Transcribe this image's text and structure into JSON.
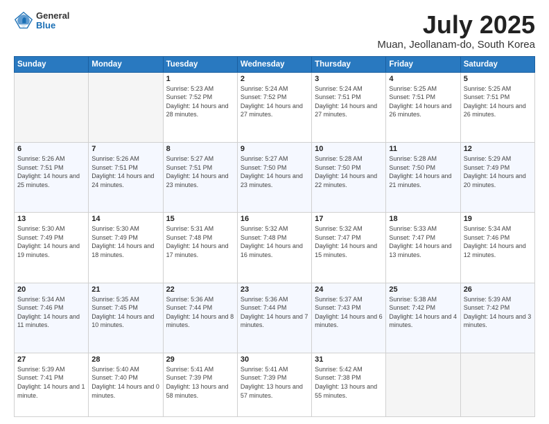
{
  "logo": {
    "general": "General",
    "blue": "Blue"
  },
  "title": {
    "month_year": "July 2025",
    "location": "Muan, Jeollanam-do, South Korea"
  },
  "weekdays": [
    "Sunday",
    "Monday",
    "Tuesday",
    "Wednesday",
    "Thursday",
    "Friday",
    "Saturday"
  ],
  "weeks": [
    [
      {
        "day": "",
        "sunrise": "",
        "sunset": "",
        "daylight": ""
      },
      {
        "day": "",
        "sunrise": "",
        "sunset": "",
        "daylight": ""
      },
      {
        "day": "1",
        "sunrise": "Sunrise: 5:23 AM",
        "sunset": "Sunset: 7:52 PM",
        "daylight": "Daylight: 14 hours and 28 minutes."
      },
      {
        "day": "2",
        "sunrise": "Sunrise: 5:24 AM",
        "sunset": "Sunset: 7:52 PM",
        "daylight": "Daylight: 14 hours and 27 minutes."
      },
      {
        "day": "3",
        "sunrise": "Sunrise: 5:24 AM",
        "sunset": "Sunset: 7:51 PM",
        "daylight": "Daylight: 14 hours and 27 minutes."
      },
      {
        "day": "4",
        "sunrise": "Sunrise: 5:25 AM",
        "sunset": "Sunset: 7:51 PM",
        "daylight": "Daylight: 14 hours and 26 minutes."
      },
      {
        "day": "5",
        "sunrise": "Sunrise: 5:25 AM",
        "sunset": "Sunset: 7:51 PM",
        "daylight": "Daylight: 14 hours and 26 minutes."
      }
    ],
    [
      {
        "day": "6",
        "sunrise": "Sunrise: 5:26 AM",
        "sunset": "Sunset: 7:51 PM",
        "daylight": "Daylight: 14 hours and 25 minutes."
      },
      {
        "day": "7",
        "sunrise": "Sunrise: 5:26 AM",
        "sunset": "Sunset: 7:51 PM",
        "daylight": "Daylight: 14 hours and 24 minutes."
      },
      {
        "day": "8",
        "sunrise": "Sunrise: 5:27 AM",
        "sunset": "Sunset: 7:51 PM",
        "daylight": "Daylight: 14 hours and 23 minutes."
      },
      {
        "day": "9",
        "sunrise": "Sunrise: 5:27 AM",
        "sunset": "Sunset: 7:50 PM",
        "daylight": "Daylight: 14 hours and 23 minutes."
      },
      {
        "day": "10",
        "sunrise": "Sunrise: 5:28 AM",
        "sunset": "Sunset: 7:50 PM",
        "daylight": "Daylight: 14 hours and 22 minutes."
      },
      {
        "day": "11",
        "sunrise": "Sunrise: 5:28 AM",
        "sunset": "Sunset: 7:50 PM",
        "daylight": "Daylight: 14 hours and 21 minutes."
      },
      {
        "day": "12",
        "sunrise": "Sunrise: 5:29 AM",
        "sunset": "Sunset: 7:49 PM",
        "daylight": "Daylight: 14 hours and 20 minutes."
      }
    ],
    [
      {
        "day": "13",
        "sunrise": "Sunrise: 5:30 AM",
        "sunset": "Sunset: 7:49 PM",
        "daylight": "Daylight: 14 hours and 19 minutes."
      },
      {
        "day": "14",
        "sunrise": "Sunrise: 5:30 AM",
        "sunset": "Sunset: 7:49 PM",
        "daylight": "Daylight: 14 hours and 18 minutes."
      },
      {
        "day": "15",
        "sunrise": "Sunrise: 5:31 AM",
        "sunset": "Sunset: 7:48 PM",
        "daylight": "Daylight: 14 hours and 17 minutes."
      },
      {
        "day": "16",
        "sunrise": "Sunrise: 5:32 AM",
        "sunset": "Sunset: 7:48 PM",
        "daylight": "Daylight: 14 hours and 16 minutes."
      },
      {
        "day": "17",
        "sunrise": "Sunrise: 5:32 AM",
        "sunset": "Sunset: 7:47 PM",
        "daylight": "Daylight: 14 hours and 15 minutes."
      },
      {
        "day": "18",
        "sunrise": "Sunrise: 5:33 AM",
        "sunset": "Sunset: 7:47 PM",
        "daylight": "Daylight: 14 hours and 13 minutes."
      },
      {
        "day": "19",
        "sunrise": "Sunrise: 5:34 AM",
        "sunset": "Sunset: 7:46 PM",
        "daylight": "Daylight: 14 hours and 12 minutes."
      }
    ],
    [
      {
        "day": "20",
        "sunrise": "Sunrise: 5:34 AM",
        "sunset": "Sunset: 7:46 PM",
        "daylight": "Daylight: 14 hours and 11 minutes."
      },
      {
        "day": "21",
        "sunrise": "Sunrise: 5:35 AM",
        "sunset": "Sunset: 7:45 PM",
        "daylight": "Daylight: 14 hours and 10 minutes."
      },
      {
        "day": "22",
        "sunrise": "Sunrise: 5:36 AM",
        "sunset": "Sunset: 7:44 PM",
        "daylight": "Daylight: 14 hours and 8 minutes."
      },
      {
        "day": "23",
        "sunrise": "Sunrise: 5:36 AM",
        "sunset": "Sunset: 7:44 PM",
        "daylight": "Daylight: 14 hours and 7 minutes."
      },
      {
        "day": "24",
        "sunrise": "Sunrise: 5:37 AM",
        "sunset": "Sunset: 7:43 PM",
        "daylight": "Daylight: 14 hours and 6 minutes."
      },
      {
        "day": "25",
        "sunrise": "Sunrise: 5:38 AM",
        "sunset": "Sunset: 7:42 PM",
        "daylight": "Daylight: 14 hours and 4 minutes."
      },
      {
        "day": "26",
        "sunrise": "Sunrise: 5:39 AM",
        "sunset": "Sunset: 7:42 PM",
        "daylight": "Daylight: 14 hours and 3 minutes."
      }
    ],
    [
      {
        "day": "27",
        "sunrise": "Sunrise: 5:39 AM",
        "sunset": "Sunset: 7:41 PM",
        "daylight": "Daylight: 14 hours and 1 minute."
      },
      {
        "day": "28",
        "sunrise": "Sunrise: 5:40 AM",
        "sunset": "Sunset: 7:40 PM",
        "daylight": "Daylight: 14 hours and 0 minutes."
      },
      {
        "day": "29",
        "sunrise": "Sunrise: 5:41 AM",
        "sunset": "Sunset: 7:39 PM",
        "daylight": "Daylight: 13 hours and 58 minutes."
      },
      {
        "day": "30",
        "sunrise": "Sunrise: 5:41 AM",
        "sunset": "Sunset: 7:39 PM",
        "daylight": "Daylight: 13 hours and 57 minutes."
      },
      {
        "day": "31",
        "sunrise": "Sunrise: 5:42 AM",
        "sunset": "Sunset: 7:38 PM",
        "daylight": "Daylight: 13 hours and 55 minutes."
      },
      {
        "day": "",
        "sunrise": "",
        "sunset": "",
        "daylight": ""
      },
      {
        "day": "",
        "sunrise": "",
        "sunset": "",
        "daylight": ""
      }
    ]
  ]
}
